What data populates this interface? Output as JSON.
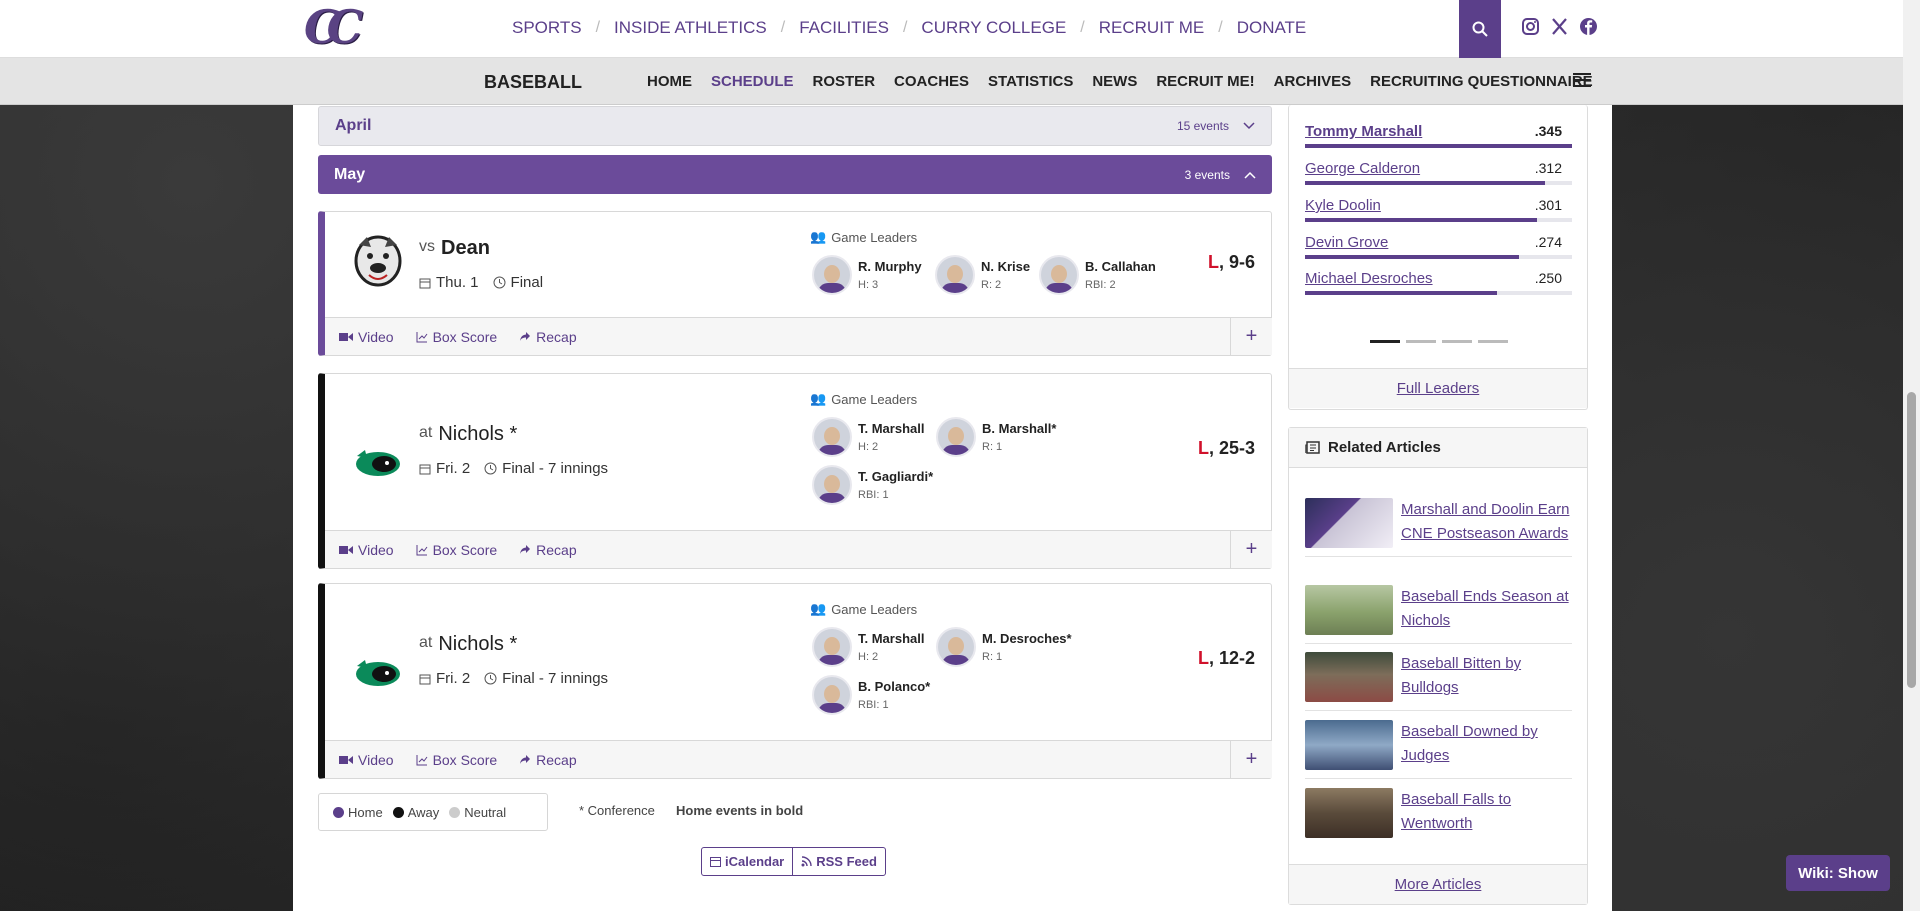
{
  "nav": {
    "logo_text": "CC",
    "items": [
      "SPORTS",
      "INSIDE ATHLETICS",
      "FACILITIES",
      "CURRY COLLEGE",
      "RECRUIT ME",
      "DONATE"
    ]
  },
  "subnav": {
    "sport": "BASEBALL",
    "items": [
      "HOME",
      "SCHEDULE",
      "ROSTER",
      "COACHES",
      "STATISTICS",
      "NEWS",
      "RECRUIT ME!",
      "ARCHIVES",
      "RECRUITING QUESTIONNAIRE"
    ]
  },
  "months": {
    "april": {
      "name": "April",
      "count": "15 events"
    },
    "may": {
      "name": "May",
      "count": "3 events"
    }
  },
  "games": [
    {
      "prefix": "vs",
      "opponent": "Dean",
      "date": "Thu. 1",
      "status": "Final",
      "leaders_label": "Game Leaders",
      "leaders": [
        {
          "name": "R. Murphy",
          "stat": "H: 3"
        },
        {
          "name": "N. Krise",
          "stat": "R: 2"
        },
        {
          "name": "B. Callahan",
          "stat": "RBI: 2"
        }
      ],
      "result_wl": "L",
      "result_score": ", 9-6"
    },
    {
      "prefix": "at",
      "opponent": "Nichols *",
      "date": "Fri. 2",
      "status": "Final - 7 innings",
      "leaders_label": "Game Leaders",
      "leaders": [
        {
          "name": "T. Marshall",
          "stat": "H: 2"
        },
        {
          "name": "B. Marshall*",
          "stat": "R: 1"
        },
        {
          "name": "T. Gagliardi*",
          "stat": "RBI: 1"
        }
      ],
      "result_wl": "L",
      "result_score": ", 25-3"
    },
    {
      "prefix": "at",
      "opponent": "Nichols *",
      "date": "Fri. 2",
      "status": "Final - 7 innings",
      "leaders_label": "Game Leaders",
      "leaders": [
        {
          "name": "T. Marshall",
          "stat": "H: 2"
        },
        {
          "name": "M. Desroches*",
          "stat": "R: 1"
        },
        {
          "name": "B. Polanco*",
          "stat": "RBI: 1"
        }
      ],
      "result_wl": "L",
      "result_score": ", 12-2"
    }
  ],
  "game_links": {
    "video": "Video",
    "box": "Box Score",
    "recap": "Recap",
    "expand": "+"
  },
  "legend": {
    "home": "Home",
    "away": "Away",
    "neutral": "Neutral",
    "conference": "* Conference",
    "home_bold": "Home events in bold"
  },
  "feeds": {
    "ical": "iCalendar",
    "rss": "RSS Feed"
  },
  "stat_leaders": {
    "players": [
      {
        "name": "Tommy Marshall",
        "value": ".345",
        "fill": 1.0
      },
      {
        "name": "George Calderon",
        "value": ".312",
        "fill": 0.9
      },
      {
        "name": "Kyle Doolin",
        "value": ".301",
        "fill": 0.87
      },
      {
        "name": "Devin Grove",
        "value": ".274",
        "fill": 0.8
      },
      {
        "name": "Michael Desroches",
        "value": ".250",
        "fill": 0.72
      }
    ],
    "full_link": "Full Leaders"
  },
  "articles": {
    "heading": "Related Articles",
    "items": [
      "Marshall and Doolin Earn CNE Postseason Awards",
      "Baseball Ends Season at Nichols",
      "Baseball Bitten by Bulldogs",
      "Baseball Downed by Judges",
      "Baseball Falls to Wentworth"
    ],
    "more": "More Articles"
  },
  "wiki": "Wiki: Show",
  "colors": {
    "brand": "#5b3f8a",
    "loss": "#d0112b",
    "home_dot": "#5b3f8a",
    "away_dot": "#111111",
    "neutral_dot": "#cccccc"
  }
}
